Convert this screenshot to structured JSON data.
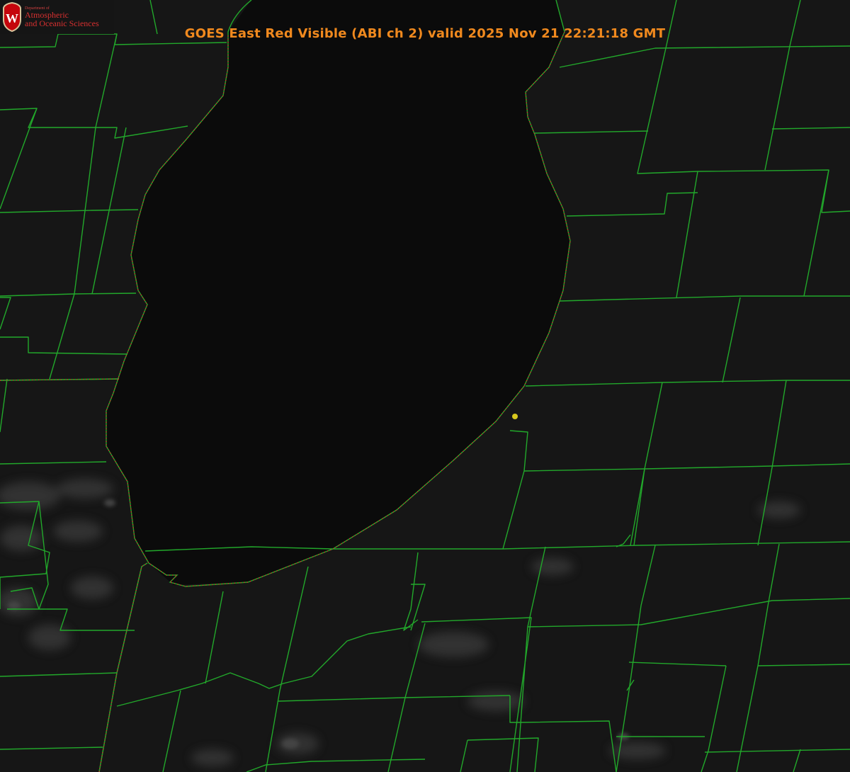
{
  "title": "GOES East Red Visible (ABI ch 2) valid 2025 Nov 21 22:21:18 GMT",
  "logo": {
    "department": "Department of",
    "line1": "Atmospheric",
    "line2": "and Oceanic Sciences",
    "emblem_letter": "W"
  },
  "colors": {
    "title": "#f0891e",
    "boundaries": "#22a82b",
    "shoreline_dots": "#d9262b",
    "station_marker": "#d8c81e",
    "lake": "#0b0b0b",
    "land": "#161616"
  },
  "map": {
    "product": "visible satellite imagery",
    "features": [
      "lake",
      "county-boundaries",
      "state-boundaries",
      "shoreline",
      "station-marker",
      "cloud-field"
    ]
  }
}
